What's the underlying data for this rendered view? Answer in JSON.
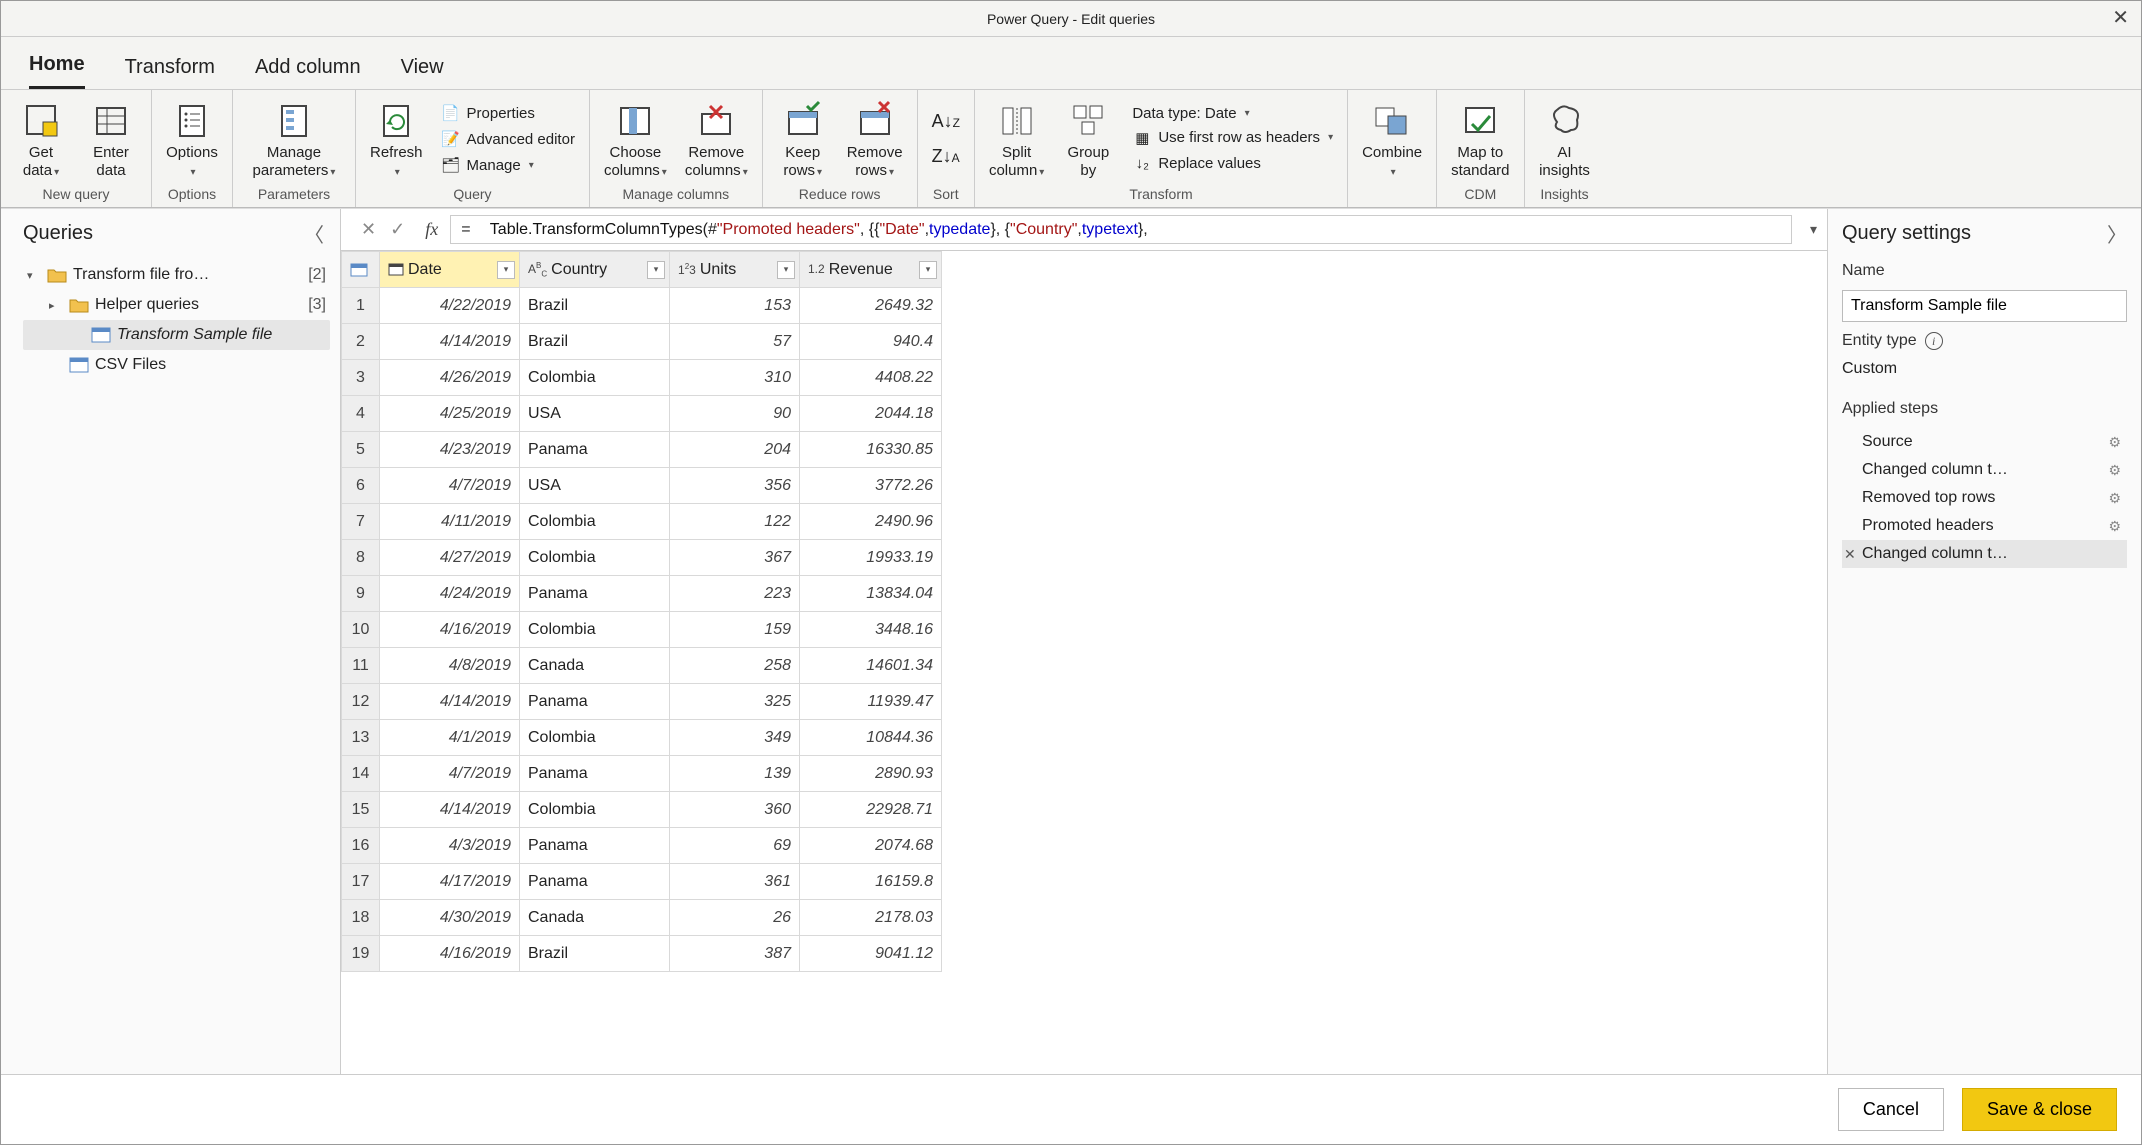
{
  "title": "Power Query - Edit queries",
  "menuTabs": {
    "home": "Home",
    "transform": "Transform",
    "addcol": "Add column",
    "view": "View"
  },
  "ribbon": {
    "newquery": {
      "get": "Get\ndata",
      "enter": "Enter\ndata",
      "label": "New query"
    },
    "options": {
      "btn": "Options",
      "label": "Options"
    },
    "parameters": {
      "btn": "Manage\nparameters",
      "label": "Parameters"
    },
    "query": {
      "refresh": "Refresh",
      "properties": "Properties",
      "advanced": "Advanced editor",
      "manage": "Manage",
      "label": "Query"
    },
    "mcols": {
      "choose": "Choose\ncolumns",
      "remove": "Remove\ncolumns",
      "label": "Manage columns"
    },
    "rrows": {
      "keep": "Keep\nrows",
      "remove": "Remove\nrows",
      "label": "Reduce rows"
    },
    "sort": {
      "label": "Sort"
    },
    "transform": {
      "split": "Split\ncolumn",
      "group": "Group\nby",
      "dtype": "Data type: Date",
      "firstrow": "Use first row as headers",
      "replace": "Replace values",
      "label": "Transform"
    },
    "combine": {
      "btn": "Combine"
    },
    "cdm": {
      "btn": "Map to\nstandard",
      "label": "CDM"
    },
    "insights": {
      "btn": "AI\ninsights",
      "label": "Insights"
    }
  },
  "queriesPanel": {
    "title": "Queries",
    "items": [
      {
        "name": "Transform file fro…",
        "count": "[2]",
        "folder": true,
        "expanded": true,
        "indent": 0
      },
      {
        "name": "Helper queries",
        "count": "[3]",
        "folder": true,
        "expanded": false,
        "indent": 1
      },
      {
        "name": "Transform Sample file",
        "table": true,
        "selected": true,
        "indent": 2
      },
      {
        "name": "CSV Files",
        "table": true,
        "indent": 1
      }
    ]
  },
  "formula": {
    "eq": "=",
    "fn": "Table.TransformColumnTypes",
    "open": "(#",
    "arg1": "\"Promoted headers\"",
    "mid1": ", {{",
    "s1": "\"Date\"",
    "c1": ", ",
    "t1a": "type ",
    "t1b": "date",
    "mid2": "}, {",
    "s2": "\"Country\"",
    "c2": ", ",
    "t2a": "type ",
    "t2b": "text",
    "end": "},"
  },
  "columns": [
    {
      "name": "Date",
      "type": "date",
      "selected": true
    },
    {
      "name": "Country",
      "type": "text"
    },
    {
      "name": "Units",
      "type": "int"
    },
    {
      "name": "Revenue",
      "type": "decimal"
    }
  ],
  "rows": [
    {
      "n": 1,
      "date": "4/22/2019",
      "country": "Brazil",
      "units": 153,
      "revenue": "2649.32"
    },
    {
      "n": 2,
      "date": "4/14/2019",
      "country": "Brazil",
      "units": 57,
      "revenue": "940.4"
    },
    {
      "n": 3,
      "date": "4/26/2019",
      "country": "Colombia",
      "units": 310,
      "revenue": "4408.22"
    },
    {
      "n": 4,
      "date": "4/25/2019",
      "country": "USA",
      "units": 90,
      "revenue": "2044.18"
    },
    {
      "n": 5,
      "date": "4/23/2019",
      "country": "Panama",
      "units": 204,
      "revenue": "16330.85"
    },
    {
      "n": 6,
      "date": "4/7/2019",
      "country": "USA",
      "units": 356,
      "revenue": "3772.26"
    },
    {
      "n": 7,
      "date": "4/11/2019",
      "country": "Colombia",
      "units": 122,
      "revenue": "2490.96"
    },
    {
      "n": 8,
      "date": "4/27/2019",
      "country": "Colombia",
      "units": 367,
      "revenue": "19933.19"
    },
    {
      "n": 9,
      "date": "4/24/2019",
      "country": "Panama",
      "units": 223,
      "revenue": "13834.04"
    },
    {
      "n": 10,
      "date": "4/16/2019",
      "country": "Colombia",
      "units": 159,
      "revenue": "3448.16"
    },
    {
      "n": 11,
      "date": "4/8/2019",
      "country": "Canada",
      "units": 258,
      "revenue": "14601.34"
    },
    {
      "n": 12,
      "date": "4/14/2019",
      "country": "Panama",
      "units": 325,
      "revenue": "11939.47"
    },
    {
      "n": 13,
      "date": "4/1/2019",
      "country": "Colombia",
      "units": 349,
      "revenue": "10844.36"
    },
    {
      "n": 14,
      "date": "4/7/2019",
      "country": "Panama",
      "units": 139,
      "revenue": "2890.93"
    },
    {
      "n": 15,
      "date": "4/14/2019",
      "country": "Colombia",
      "units": 360,
      "revenue": "22928.71"
    },
    {
      "n": 16,
      "date": "4/3/2019",
      "country": "Panama",
      "units": 69,
      "revenue": "2074.68"
    },
    {
      "n": 17,
      "date": "4/17/2019",
      "country": "Panama",
      "units": 361,
      "revenue": "16159.8"
    },
    {
      "n": 18,
      "date": "4/30/2019",
      "country": "Canada",
      "units": 26,
      "revenue": "2178.03"
    },
    {
      "n": 19,
      "date": "4/16/2019",
      "country": "Brazil",
      "units": 387,
      "revenue": "9041.12"
    }
  ],
  "querySettings": {
    "title": "Query settings",
    "nameLabel": "Name",
    "nameValue": "Transform Sample file",
    "entityLabel": "Entity type",
    "entityValue": "Custom",
    "stepsLabel": "Applied steps",
    "steps": [
      {
        "name": "Source",
        "gear": true
      },
      {
        "name": "Changed column t…",
        "gear": true
      },
      {
        "name": "Removed top rows",
        "gear": true
      },
      {
        "name": "Promoted headers",
        "gear": true
      },
      {
        "name": "Changed column t…",
        "selected": true,
        "del": true
      }
    ]
  },
  "footer": {
    "cancel": "Cancel",
    "save": "Save & close"
  }
}
